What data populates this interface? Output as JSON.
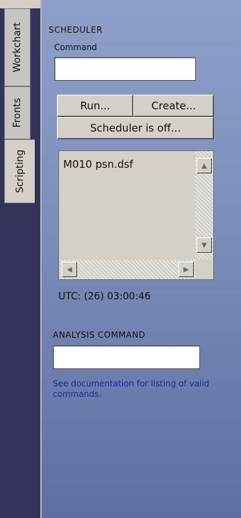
{
  "tabs": [
    {
      "label": "Workchart",
      "active": false
    },
    {
      "label": "Fronts",
      "active": false
    },
    {
      "label": "Scripting",
      "active": true
    }
  ],
  "scheduler": {
    "title": "SCHEDULER",
    "command_label": "Command",
    "command_value": "",
    "run_label": "Run...",
    "create_label": "Create...",
    "status_button_label": "Scheduler is off...",
    "files": [
      "M010 psn.dsf"
    ],
    "utc": "UTC: (26) 03:00:46"
  },
  "analysis": {
    "title": "ANALYSIS COMMAND",
    "command_value": "",
    "help_text": "See documentation for listing of valid commands."
  },
  "colors": {
    "rail": "#33335c",
    "panel_top": "#8ea0c9",
    "panel_bottom": "#5f6fa0",
    "help_text": "#1b2b9a"
  },
  "icons": {
    "scroll_up": "up-arrow-icon",
    "scroll_down": "down-arrow-icon",
    "scroll_left": "left-arrow-icon",
    "scroll_right": "right-arrow-icon"
  }
}
